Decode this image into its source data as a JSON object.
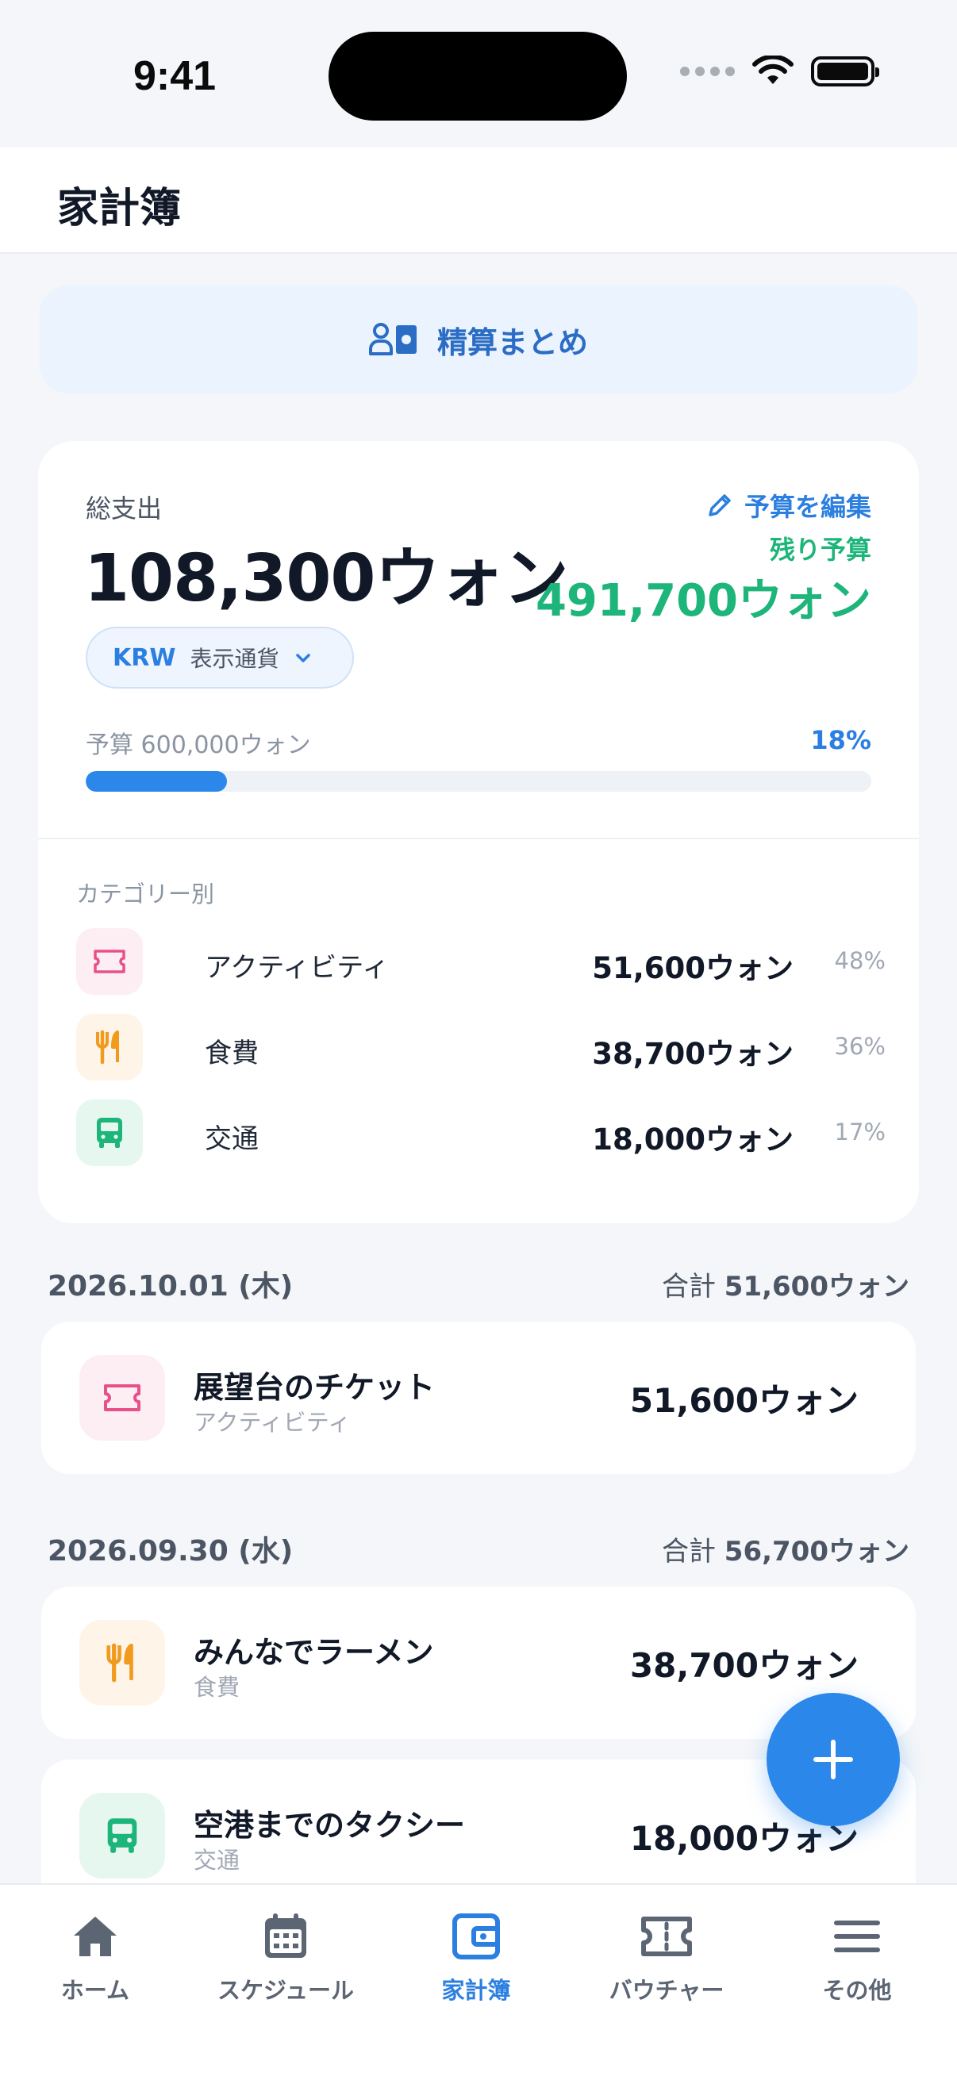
{
  "status_bar": {
    "time": "9:41"
  },
  "header": {
    "title": "家計簿"
  },
  "settle_button": {
    "label": "精算まとめ",
    "icon": "people-money-icon"
  },
  "summary": {
    "total_label": "総支出",
    "total_value": "108,300ウォン",
    "edit_budget_label": "予算を編集",
    "remaining_label": "残り予算",
    "remaining_value": "491,700ウォン",
    "currency_code": "KRW",
    "currency_label": "表示通貨",
    "budget_label": "予算 600,000ウォン",
    "budget_percent": "18%",
    "budget_progress": 0.18,
    "category_heading": "カテゴリー別",
    "categories": [
      {
        "name": "アクティビティ",
        "amount": "51,600ウォン",
        "percent": "48%",
        "icon": "ticket-icon",
        "color": "#E8508A"
      },
      {
        "name": "食費",
        "amount": "38,700ウォン",
        "percent": "36%",
        "icon": "fork-knife-icon",
        "color": "#F09A1E"
      },
      {
        "name": "交通",
        "amount": "18,000ウォン",
        "percent": "17%",
        "icon": "bus-icon",
        "color": "#1DB57A"
      }
    ]
  },
  "days": [
    {
      "date": "2026.10.01 (木)",
      "total_prefix": "合計",
      "total": "51,600ウォン",
      "items": [
        {
          "title": "展望台のチケット",
          "category": "アクティビティ",
          "amount": "51,600ウォン",
          "icon": "ticket-icon"
        }
      ]
    },
    {
      "date": "2026.09.30 (水)",
      "total_prefix": "合計",
      "total": "56,700ウォン",
      "items": [
        {
          "title": "みんなでラーメン",
          "category": "食費",
          "amount": "38,700ウォン",
          "icon": "fork-knife-icon"
        },
        {
          "title": "空港までのタクシー",
          "category": "交通",
          "amount": "18,000ウォン",
          "icon": "bus-icon"
        }
      ]
    }
  ],
  "fab": {
    "icon": "plus-icon"
  },
  "tabs": [
    {
      "label": "ホーム",
      "icon": "home-icon",
      "active": false
    },
    {
      "label": "スケジュール",
      "icon": "calendar-icon",
      "active": false
    },
    {
      "label": "家計簿",
      "icon": "wallet-icon",
      "active": true
    },
    {
      "label": "バウチャー",
      "icon": "voucher-icon",
      "active": false
    },
    {
      "label": "その他",
      "icon": "menu-icon",
      "active": false
    }
  ],
  "colors": {
    "accent": "#2B7FE0",
    "positive": "#1DB57A",
    "background": "#F4F6F9"
  }
}
